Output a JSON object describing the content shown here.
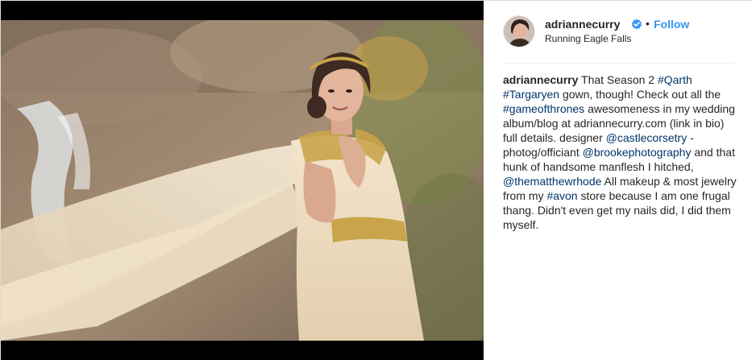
{
  "post": {
    "username": "adriannecurry",
    "follow_label": "Follow",
    "separator": "•",
    "location": "Running Eagle Falls"
  },
  "icons": {
    "verified": "verified-badge-icon",
    "verified_color": "#3897f0"
  },
  "caption": {
    "username": "adriannecurry",
    "segments": [
      {
        "type": "text",
        "value": " That Season 2 "
      },
      {
        "type": "link",
        "value": "#Qarth"
      },
      {
        "type": "text",
        "value": " "
      },
      {
        "type": "link",
        "value": "#Targaryen"
      },
      {
        "type": "text",
        "value": " gown, though! Check out all the "
      },
      {
        "type": "link",
        "value": "#gameofthrones"
      },
      {
        "type": "text",
        "value": " awesomeness in my wedding album/blog at adriannecurry.com (link in bio) full details. designer "
      },
      {
        "type": "link",
        "value": "@castlecorsetry"
      },
      {
        "type": "text",
        "value": " - photog/officiant "
      },
      {
        "type": "link",
        "value": "@brookephotography"
      },
      {
        "type": "text",
        "value": " and that hunk of handsome manflesh I hitched, "
      },
      {
        "type": "link",
        "value": "@thematthewrhode"
      },
      {
        "type": "text",
        "value": " All makeup & most jewelry from my "
      },
      {
        "type": "link",
        "value": "#avon"
      },
      {
        "type": "text",
        "value": " store because I am one frugal thang. Didn't even get my nails did, I did them myself."
      }
    ]
  },
  "colors": {
    "link": "#003569",
    "follow": "#3897f0",
    "text": "#262626",
    "border": "#dbdbdb"
  }
}
